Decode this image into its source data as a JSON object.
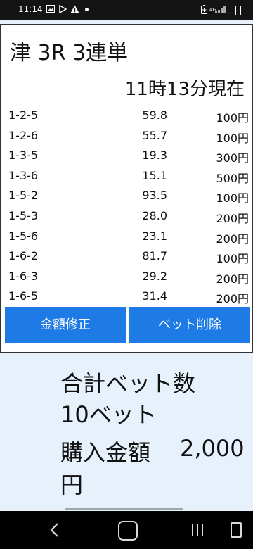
{
  "status_bar": {
    "time": "11:14",
    "network": "4G",
    "icons": [
      "gallery-icon",
      "play-store-icon",
      "warning-icon",
      "dot-icon",
      "battery-saver-icon",
      "signal-icon",
      "battery-icon"
    ]
  },
  "race": {
    "title": "津 3R 3連単",
    "as_of": "11時13分現在"
  },
  "bets": [
    {
      "combo": "1-2-5",
      "odds": "59.8",
      "amount": "100円"
    },
    {
      "combo": "1-2-6",
      "odds": "55.7",
      "amount": "100円"
    },
    {
      "combo": "1-3-5",
      "odds": "19.3",
      "amount": "300円"
    },
    {
      "combo": "1-3-6",
      "odds": "15.1",
      "amount": "500円"
    },
    {
      "combo": "1-5-2",
      "odds": "93.5",
      "amount": "100円"
    },
    {
      "combo": "1-5-3",
      "odds": "28.0",
      "amount": "200円"
    },
    {
      "combo": "1-5-6",
      "odds": "23.1",
      "amount": "200円"
    },
    {
      "combo": "1-6-2",
      "odds": "81.7",
      "amount": "100円"
    },
    {
      "combo": "1-6-3",
      "odds": "29.2",
      "amount": "200円"
    },
    {
      "combo": "1-6-5",
      "odds": "31.4",
      "amount": "200円"
    }
  ],
  "buttons": {
    "edit_amount": "金額修正",
    "delete_bet": "ベット削除"
  },
  "summary": {
    "total_label": "合計ベット数",
    "total_count": "10ベット",
    "amount_label": "購入金額",
    "amount_value": "2,000",
    "amount_unit": "円"
  },
  "colors": {
    "button": "#1e7ae5",
    "summary_bg": "#e7f1fb",
    "status_bar": "#141414"
  }
}
